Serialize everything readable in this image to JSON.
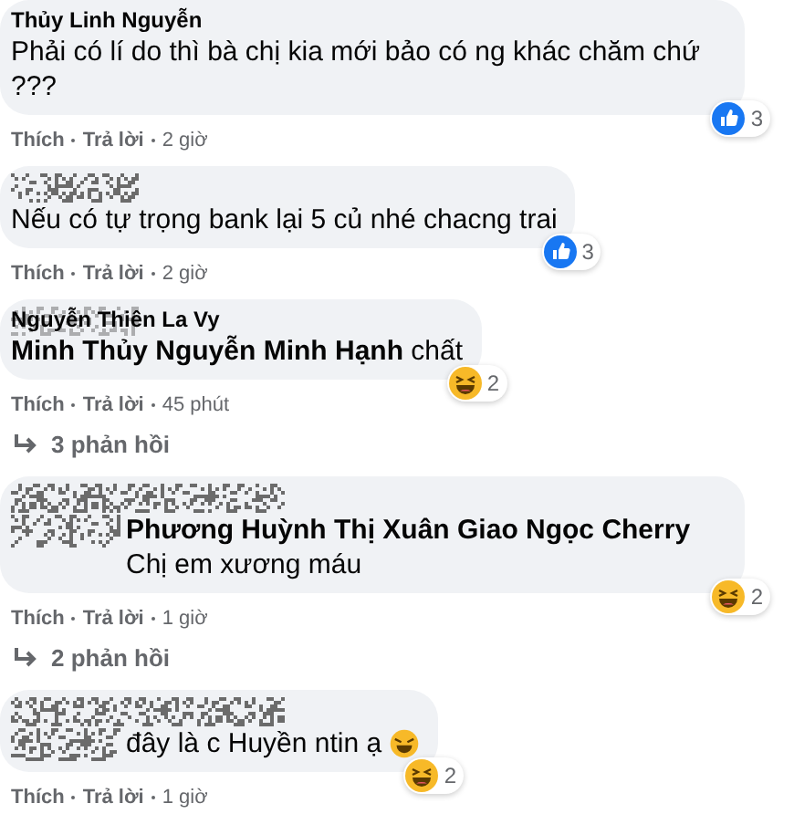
{
  "comments": [
    {
      "author": "Thủy Linh Nguyễn",
      "author_redacted": false,
      "text_redacted": false,
      "text": "Phải có lí do thì bà chị kia mới bảo có ng khác chăm chứ ???",
      "reaction": {
        "kind": "like",
        "count": "3"
      },
      "actions": [
        "Thích",
        "Trả lời"
      ],
      "time": "2 giờ"
    },
    {
      "author_redacted": true,
      "text_redacted": false,
      "text": "Nếu có tự trọng bank lại 5 củ nhé chacng trai",
      "reaction": {
        "kind": "like",
        "count": "3"
      },
      "actions": [
        "Thích",
        "Trả lời"
      ],
      "time": "2 giờ"
    },
    {
      "author": "Nguyễn Thiên La Vy",
      "author_redacted": true,
      "text_redacted": false,
      "text": "**Minh Thủy Nguyễn Minh Hạnh** chất",
      "reaction": {
        "kind": "haha",
        "count": "2"
      },
      "actions": [
        "Thích",
        "Trả lời"
      ],
      "time": "45 phút",
      "replies": "3 phản hồi"
    },
    {
      "author_redacted": true,
      "text_redacted": true,
      "text": "**Phương Huỳnh Thị Xuân Giao Ngọc Cherry** Chị em xương máu",
      "reaction": {
        "kind": "haha",
        "count": "2"
      },
      "actions": [
        "Thích",
        "Trả lời"
      ],
      "time": "1 giờ",
      "replies": "2 phản hồi"
    },
    {
      "author_redacted": true,
      "text_redacted": true,
      "text": "đây là c Huyền ntin ạ",
      "laughing_emoji": true,
      "reaction": {
        "kind": "haha",
        "count": "2"
      },
      "actions": [
        "Thích",
        "Trả lời"
      ],
      "time": "1 giờ"
    }
  ]
}
